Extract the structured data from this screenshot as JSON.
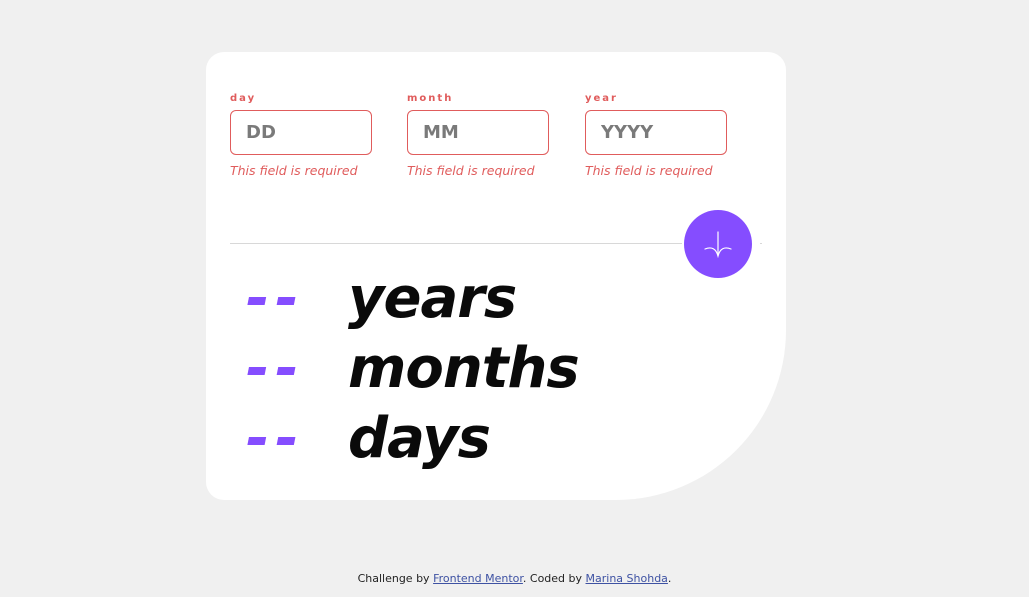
{
  "form": {
    "fields": [
      {
        "label": "day",
        "placeholder": "DD",
        "error": "This field is required"
      },
      {
        "label": "month",
        "placeholder": "MM",
        "error": "This field is required"
      },
      {
        "label": "year",
        "placeholder": "YYYY",
        "error": "This field is required"
      }
    ],
    "submit_icon": "arrow-down-icon"
  },
  "results": [
    {
      "value": "--",
      "unit": "years"
    },
    {
      "value": "--",
      "unit": "months"
    },
    {
      "value": "--",
      "unit": "days"
    }
  ],
  "footer": {
    "prefix": "Challenge by ",
    "link1": "Frontend Mentor",
    "middle": ". Coded by ",
    "link2": "Marina Shohda",
    "suffix": "."
  },
  "colors": {
    "accent": "#854dff",
    "error": "#e05c5c",
    "background": "#f0f0f0",
    "card": "#ffffff"
  }
}
